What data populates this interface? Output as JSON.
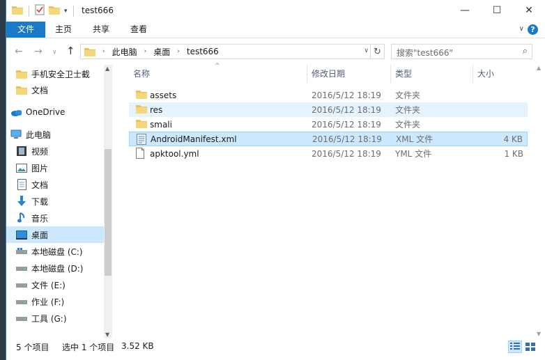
{
  "window": {
    "title": "test666",
    "controls": {
      "minimize": "—",
      "maximize": "☐",
      "close": "✕"
    }
  },
  "ribbon": {
    "tabs": [
      "文件",
      "主页",
      "共享",
      "查看"
    ],
    "expand": "∨",
    "help": "?"
  },
  "address": {
    "crumbs": [
      "此电脑",
      "桌面",
      "test666"
    ],
    "refresh": "↻"
  },
  "search": {
    "placeholder": "搜索\"test666\""
  },
  "sidebar": {
    "items": [
      {
        "label": "手机安全卫士截",
        "icon": "folder-icon"
      },
      {
        "label": "文档",
        "icon": "folder-icon"
      },
      {
        "label": "OneDrive",
        "icon": "onedrive-icon"
      },
      {
        "label": "此电脑",
        "icon": "computer-icon"
      },
      {
        "label": "视频",
        "icon": "video-icon"
      },
      {
        "label": "图片",
        "icon": "picture-icon"
      },
      {
        "label": "文档",
        "icon": "document-icon"
      },
      {
        "label": "下载",
        "icon": "download-icon"
      },
      {
        "label": "音乐",
        "icon": "music-icon"
      },
      {
        "label": "桌面",
        "icon": "desktop-icon"
      },
      {
        "label": "本地磁盘 (C:)",
        "icon": "drive-icon"
      },
      {
        "label": "本地磁盘 (D:)",
        "icon": "drive-icon"
      },
      {
        "label": "文件 (E:)",
        "icon": "drive-icon"
      },
      {
        "label": "作业 (F:)",
        "icon": "drive-icon"
      },
      {
        "label": "工具 (G:)",
        "icon": "drive-icon"
      }
    ]
  },
  "columns": {
    "name": "名称",
    "date": "修改日期",
    "type": "类型",
    "size": "大小"
  },
  "files": [
    {
      "name": "assets",
      "date": "2016/5/12 18:19",
      "type": "文件夹",
      "size": "",
      "icon": "folder-icon"
    },
    {
      "name": "res",
      "date": "2016/5/12 18:19",
      "type": "文件夹",
      "size": "",
      "icon": "folder-icon"
    },
    {
      "name": "smali",
      "date": "2016/5/12 18:19",
      "type": "文件夹",
      "size": "",
      "icon": "folder-icon"
    },
    {
      "name": "AndroidManifest.xml",
      "date": "2016/5/12 18:19",
      "type": "XML 文件",
      "size": "4 KB",
      "icon": "xml-file-icon"
    },
    {
      "name": "apktool.yml",
      "date": "2016/5/12 18:19",
      "type": "YML 文件",
      "size": "1 KB",
      "icon": "text-file-icon"
    }
  ],
  "status": {
    "count": "5 个项目",
    "selected": "选中 1 个项目",
    "selected_size": "3.52 KB"
  },
  "colors": {
    "accent": "#1979ca",
    "selection": "#cce8ff",
    "hover": "#e5f3ff",
    "folder": "#e8c35d"
  }
}
